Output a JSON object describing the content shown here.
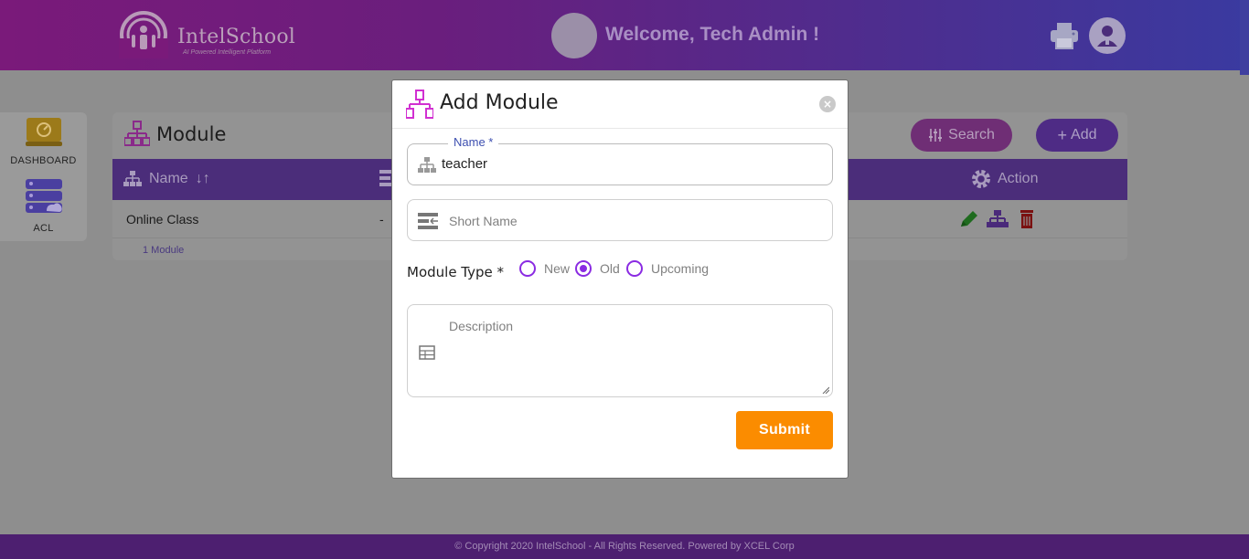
{
  "header": {
    "logo_text": "IntelSchool",
    "logo_tagline": "AI Powered Intelligent Platform",
    "welcome": "Welcome, Tech Admin !"
  },
  "sidebar": {
    "items": [
      {
        "label": "DASHBOARD",
        "icon": "dashboard-icon"
      },
      {
        "label": "ACL",
        "icon": "acl-icon"
      }
    ]
  },
  "module_page": {
    "title": "Module",
    "search_label": "Search",
    "add_label": "Add",
    "columns": {
      "name": "Name",
      "action": "Action"
    },
    "rows": [
      {
        "name": "Online Class",
        "col2": "-"
      }
    ],
    "count_text": "1 Module"
  },
  "modal": {
    "title": "Add Module",
    "name_label": "Name *",
    "name_value": "teacher",
    "short_name_placeholder": "Short Name",
    "module_type_label": "Module Type *",
    "module_type_options": [
      "New",
      "Old",
      "Upcoming"
    ],
    "module_type_selected": "Old",
    "description_placeholder": "Description",
    "submit_label": "Submit",
    "accent_color": "#8a2be2",
    "submit_color": "#fb8c00"
  },
  "footer": {
    "text": "© Copyright 2020 IntelSchool - All Rights Reserved. Powered by XCEL Corp"
  }
}
